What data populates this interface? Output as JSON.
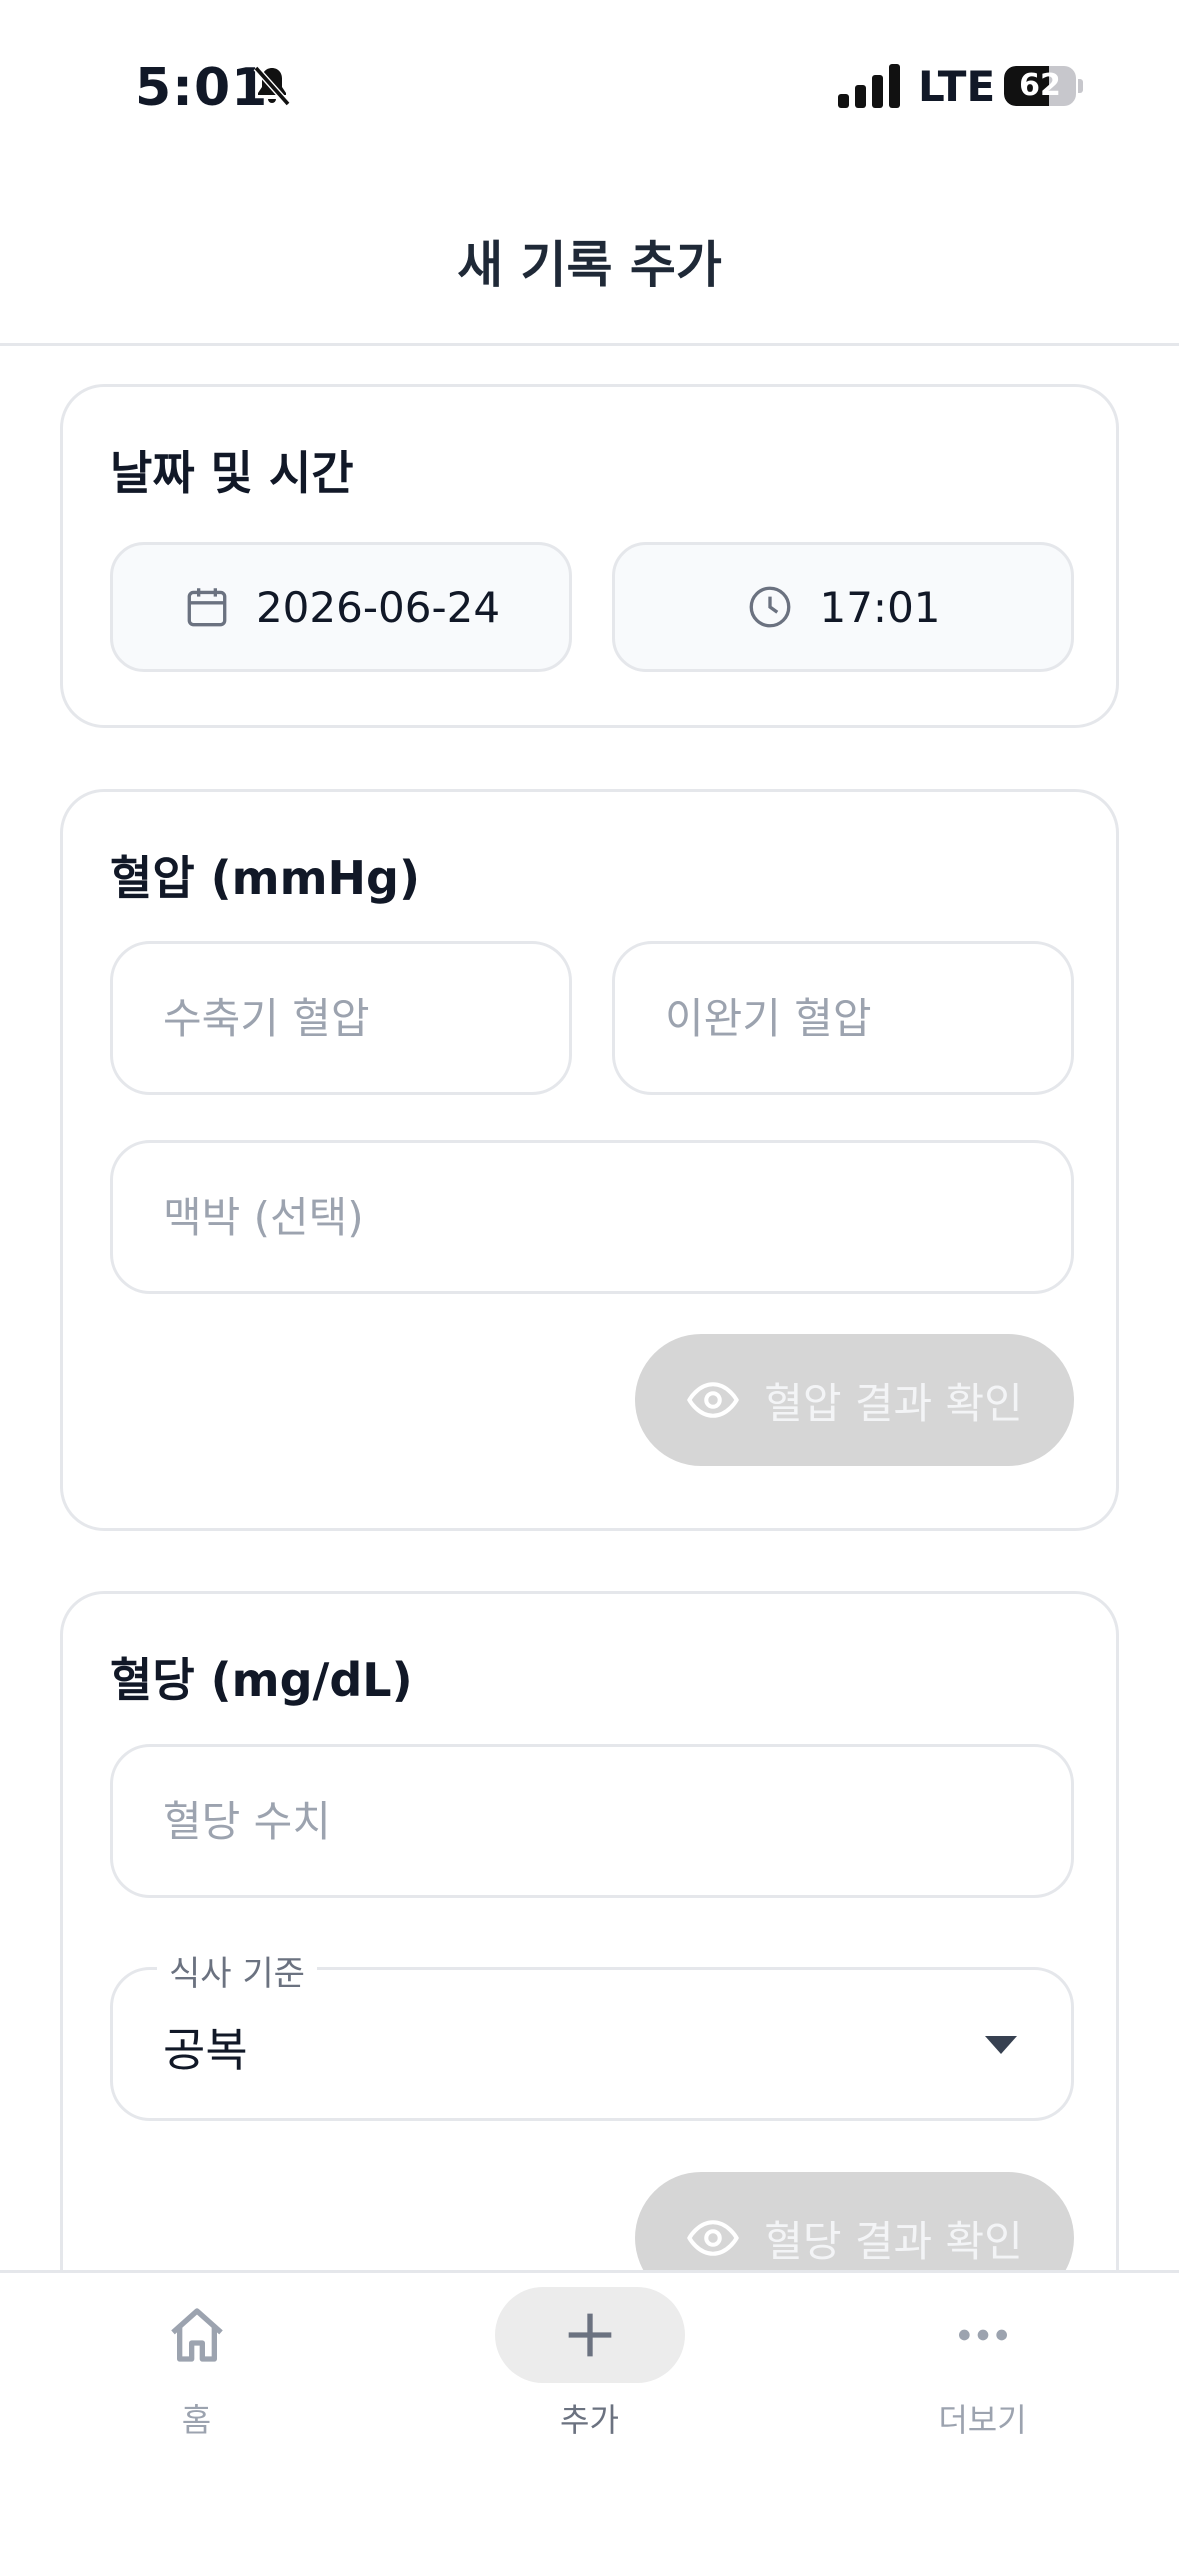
{
  "status_bar": {
    "time": "5:01",
    "network": "LTE",
    "battery": {
      "percent": "62",
      "level": 0.62
    }
  },
  "header": {
    "title": "새 기록 추가"
  },
  "date_time_card": {
    "title": "날짜 및 시간",
    "date": "2026-06-24",
    "time": "17:01"
  },
  "blood_pressure_card": {
    "title": "혈압 (mmHg)",
    "systolic_placeholder": "수축기 혈압",
    "diastolic_placeholder": "이완기 혈압",
    "pulse_placeholder": "맥박 (선택)",
    "systolic_value": "",
    "diastolic_value": "",
    "pulse_value": "",
    "result_button": "혈압 결과 확인"
  },
  "blood_sugar_card": {
    "title": "혈당 (mg/dL)",
    "value_placeholder": "혈당 수치",
    "value": "",
    "meal_label": "식사 기준",
    "meal_value": "공복",
    "result_button": "혈당 결과 확인"
  },
  "bottom_nav": {
    "items": [
      {
        "label": "홈",
        "icon": "home-icon",
        "active": false
      },
      {
        "label": "추가",
        "icon": "plus-icon",
        "active": true
      },
      {
        "label": "더보기",
        "icon": "more-icon",
        "active": false
      }
    ]
  },
  "colors": {
    "text": "#111827",
    "border": "#e5e7eb",
    "placeholder": "#9ca3af",
    "disabled_button": "#d6d6d6",
    "active_nav_bg": "#ececec"
  }
}
